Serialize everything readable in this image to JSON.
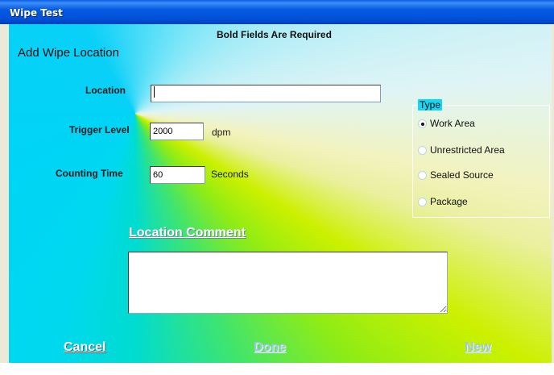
{
  "window": {
    "title": "Wipe Test"
  },
  "form": {
    "title": "Add Wipe Location",
    "required_note": "Bold Fields Are Required"
  },
  "fields": {
    "location": {
      "label": "Location",
      "value": ""
    },
    "trigger_level": {
      "label": "Trigger Level",
      "value": "2000",
      "unit": "dpm"
    },
    "counting_time": {
      "label": "Counting Time",
      "value": "60",
      "unit": "Seconds"
    }
  },
  "type_group": {
    "legend": "Type",
    "options": [
      {
        "label": "Work Area",
        "checked": true
      },
      {
        "label": "Unrestricted Area",
        "checked": false
      },
      {
        "label": "Sealed Source",
        "checked": false
      },
      {
        "label": "Package",
        "checked": false
      }
    ]
  },
  "comment": {
    "heading": "Location Comment",
    "value": ""
  },
  "buttons": {
    "cancel": "Cancel",
    "done": "Done",
    "new": "New"
  }
}
